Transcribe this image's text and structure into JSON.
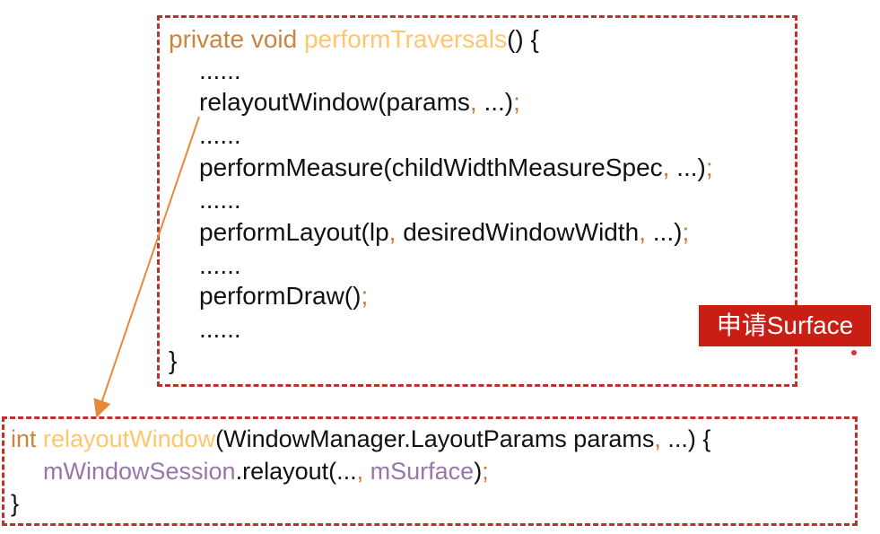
{
  "top_code": [
    [
      [
        "private void ",
        "kw"
      ],
      [
        "performTraversals",
        "fn"
      ],
      [
        "() {",
        "tx"
      ]
    ],
    [
      [
        "......",
        "tx"
      ]
    ],
    [
      [
        "relayoutWindow(params",
        "tx"
      ],
      [
        ",",
        "pn"
      ],
      [
        " ...)",
        "tx"
      ],
      [
        ";",
        "pn"
      ]
    ],
    [
      [
        "......",
        "tx"
      ]
    ],
    [
      [
        "performMeasure(childWidthMeasureSpec",
        "tx"
      ],
      [
        ",",
        "pn"
      ],
      [
        " ...)",
        "tx"
      ],
      [
        ";",
        "pn"
      ]
    ],
    [
      [
        "......",
        "tx"
      ]
    ],
    [
      [
        "performLayout(lp",
        "tx"
      ],
      [
        ",",
        "pn"
      ],
      [
        " desiredWindowWidth",
        "tx"
      ],
      [
        ",",
        "pn"
      ],
      [
        " ...)",
        "tx"
      ],
      [
        ";",
        "pn"
      ]
    ],
    [
      [
        "......",
        "tx"
      ]
    ],
    [
      [
        "performDraw()",
        "tx"
      ],
      [
        ";",
        "pn"
      ]
    ],
    [
      [
        "......",
        "tx"
      ]
    ],
    [
      [
        "}",
        "tx"
      ]
    ]
  ],
  "bottom_code": [
    [
      [
        "int ",
        "kw"
      ],
      [
        "relayoutWindow",
        "fn"
      ],
      [
        "(WindowManager.LayoutParams params",
        "tx"
      ],
      [
        ",",
        "pn"
      ],
      [
        " ...) {",
        "tx"
      ]
    ],
    [
      [
        "mWindowSession",
        "pu"
      ],
      [
        ".relayout(...",
        "tx"
      ],
      [
        ",",
        "pn"
      ],
      [
        " mSurface",
        "pu"
      ],
      [
        ")",
        "tx"
      ],
      [
        ";",
        "pn"
      ]
    ],
    [
      [
        "}",
        "tx"
      ]
    ]
  ],
  "annotation": {
    "label": "申请Surface",
    "color": "#c81e14"
  },
  "colors": {
    "border": "#c0302a",
    "arrow": "#e8893a",
    "keyword": "#c8853e",
    "function": "#ffc66d",
    "field": "#9876aa",
    "punct": "#cc7832"
  }
}
